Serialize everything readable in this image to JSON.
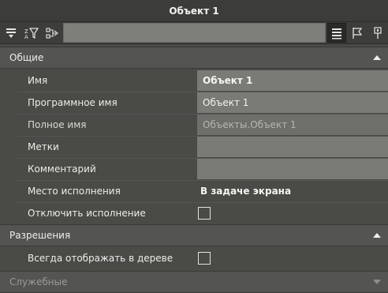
{
  "window": {
    "title": "Объект 1"
  },
  "toolbar": {
    "left_icons": [
      "collapse-rows-icon",
      "filter-icon",
      "structure-icon"
    ],
    "search": {
      "value": "",
      "placeholder": ""
    },
    "right_icons": [
      "list-view-icon",
      "flag-icon",
      "pin-icon"
    ],
    "active_right": "list-view-icon"
  },
  "sections": {
    "general": {
      "label": "Общие",
      "expanded": true,
      "rows": {
        "name": {
          "label": "Имя",
          "value": "Объект 1"
        },
        "program_name": {
          "label": "Программное имя",
          "value": "Объект 1"
        },
        "full_name": {
          "label": "Полное имя",
          "value": "Объекты.Объект 1"
        },
        "tags": {
          "label": "Метки",
          "value": ""
        },
        "comment": {
          "label": "Комментарий",
          "value": ""
        },
        "exec_place": {
          "label": "Место исполнения",
          "value": "В задаче экрана"
        },
        "disable_exec": {
          "label": "Отключить исполнение",
          "checked": false
        }
      }
    },
    "permissions": {
      "label": "Разрешения",
      "expanded": true,
      "rows": {
        "always_show": {
          "label": "Всегда отображать в дереве",
          "checked": false
        }
      }
    },
    "service": {
      "label": "Служебные",
      "expanded": false
    }
  },
  "colors": {
    "background": "#4a4a47",
    "field": "#7a7a77",
    "header": "#545452",
    "titlebar": "#3c3c3a"
  }
}
